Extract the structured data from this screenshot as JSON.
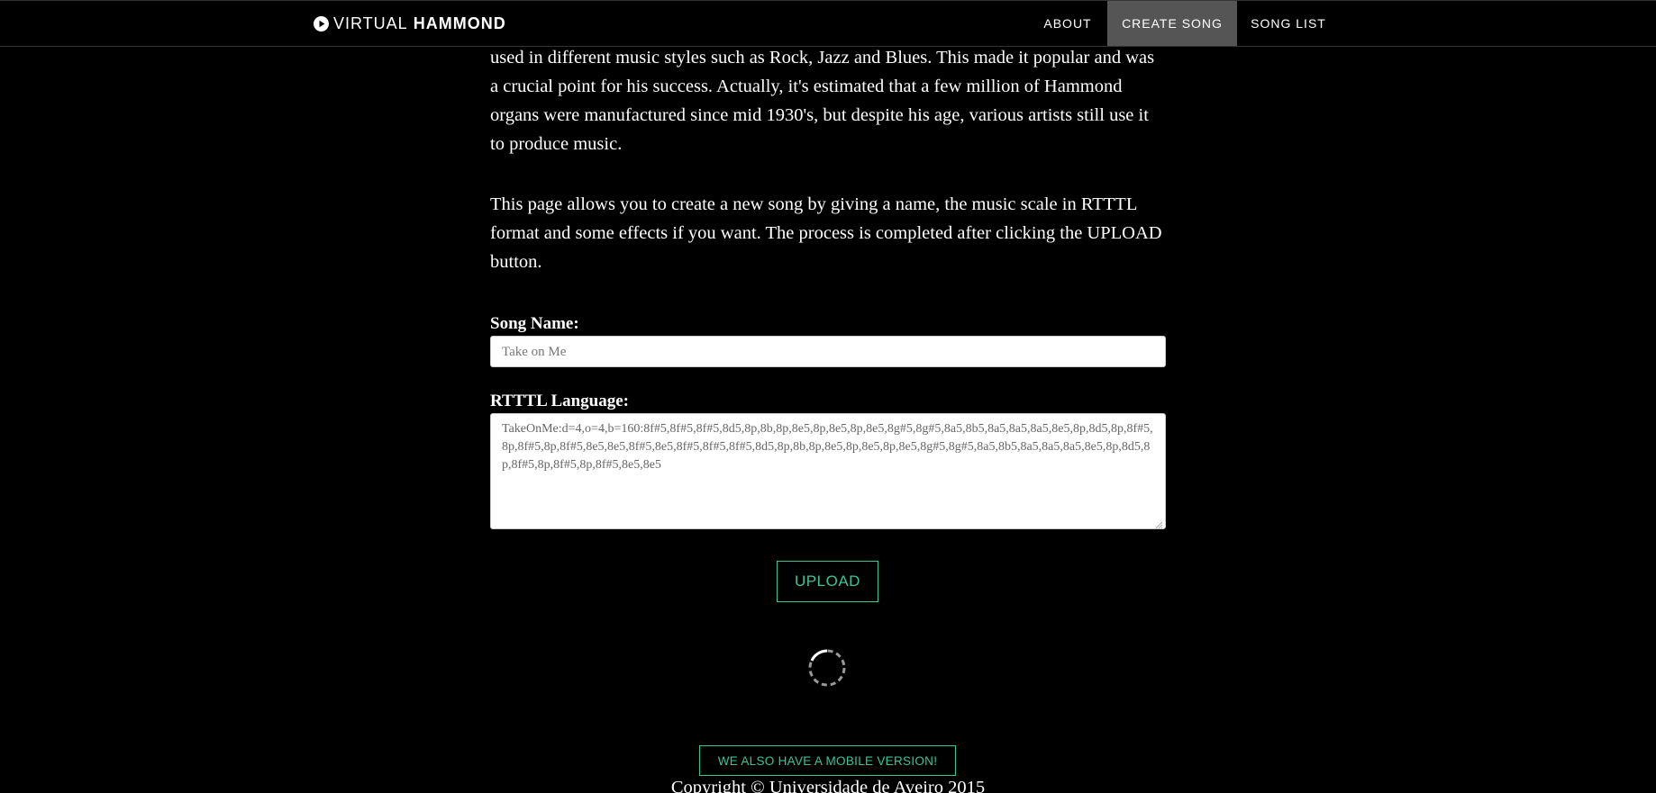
{
  "nav": {
    "brand_light": "VIRTUAL",
    "brand_bold": "HAMMOND",
    "brand_icon": "play-circle-icon",
    "items": [
      {
        "label": "ABOUT",
        "active": false
      },
      {
        "label": "CREATE SONG",
        "active": true
      },
      {
        "label": "SONG LIST",
        "active": false
      }
    ]
  },
  "main": {
    "para1": "used in different music styles such as Rock, Jazz and Blues. This made it popular and was a crucial point for his success. Actually, it's estimated that a few million of Hammond organs were manufactured since mid 1930's, but despite his age, various artists still use it to produce music.",
    "para2": "This page allows you to create a new song by giving a name, the music scale in RTTTL format and some effects if you want. The process is completed after clicking the UPLOAD button.",
    "song_name_label": "Song Name:",
    "song_name_placeholder": "Take on Me",
    "rtttl_label": "RTTTL Language:",
    "rtttl_placeholder": "TakeOnMe:d=4,o=4,b=160:8f#5,8f#5,8f#5,8d5,8p,8b,8p,8e5,8p,8e5,8p,8e5,8g#5,8g#5,8a5,8b5,8a5,8a5,8a5,8e5,8p,8d5,8p,8f#5,8p,8f#5,8p,8f#5,8e5,8e5,8f#5,8e5,8f#5,8f#5,8f#5,8d5,8p,8b,8p,8e5,8p,8e5,8p,8e5,8g#5,8g#5,8a5,8b5,8a5,8a5,8a5,8e5,8p,8d5,8p,8f#5,8p,8f#5,8p,8f#5,8e5,8e5",
    "upload_label": "UPLOAD"
  },
  "footer": {
    "mobile_label": "WE ALSO HAVE A MOBILE VERSION!",
    "copyright": "Copyright © Universidade de Aveiro 2015"
  },
  "colors": {
    "accent": "#3bc49a",
    "background": "#000000",
    "nav_active": "#555555"
  }
}
